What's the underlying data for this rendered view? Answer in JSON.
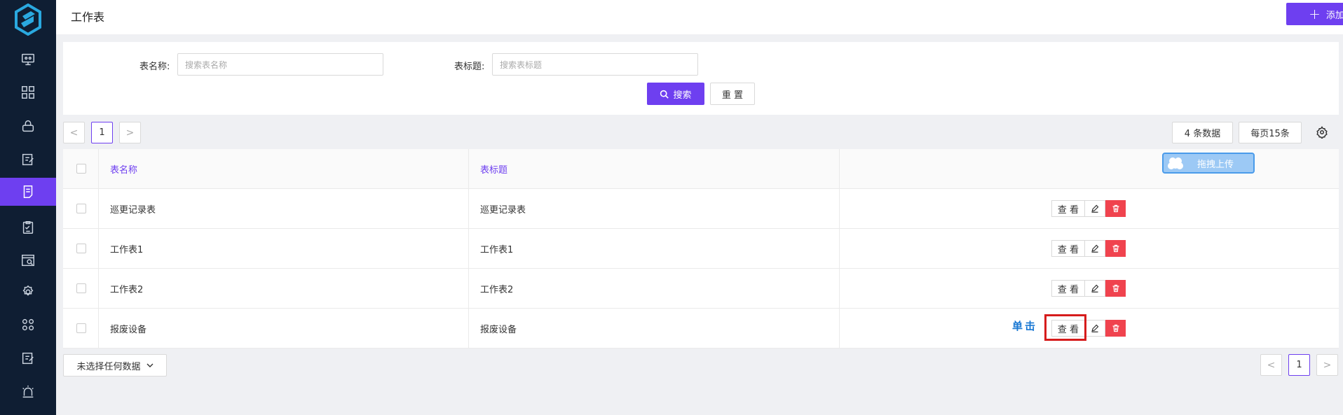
{
  "header": {
    "title": "工作表",
    "add_button": "添加工作表"
  },
  "sidebar": {
    "active_index": 4,
    "items": [
      "monitor-icon",
      "grid-icon",
      "lock-icon",
      "edit-doc-icon",
      "note-icon",
      "clipboard-check-icon",
      "window-search-icon",
      "settings-icon",
      "apps-icon",
      "edit-doc-icon-2",
      "alarm-light-icon"
    ]
  },
  "search": {
    "name_label": "表名称:",
    "name_placeholder": "搜索表名称",
    "title_label": "表标题:",
    "title_placeholder": "搜索表标题",
    "search_button": "搜索",
    "reset_button": "重 置"
  },
  "pagination": {
    "prev": "<",
    "current": "1",
    "next": ">",
    "total": "4 条数据",
    "page_size": "每页15条"
  },
  "table": {
    "columns": [
      "表名称",
      "表标题"
    ],
    "rows": [
      {
        "name": "巡更记录表",
        "title": "巡更记录表"
      },
      {
        "name": "工作表1",
        "title": "工作表1"
      },
      {
        "name": "工作表2",
        "title": "工作表2"
      },
      {
        "name": "报废设备",
        "title": "报废设备"
      }
    ],
    "action_view": "查 看"
  },
  "overlay": {
    "upload": "拖拽上传",
    "click_hint": "单击"
  },
  "footer": {
    "selection": "未选择任何数据"
  },
  "colors": {
    "accent": "#6e3ff0",
    "sidebar": "#0f1e33",
    "danger": "#f0434e"
  }
}
